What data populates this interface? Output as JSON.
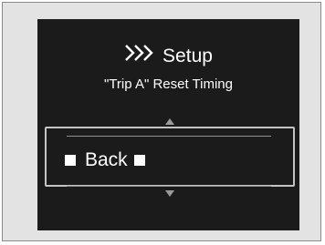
{
  "screen": {
    "title": "Setup",
    "title_icon": "triple-chevron-right-icon",
    "subtitle": "\"Trip A\" Reset Timing"
  },
  "selector": {
    "selected_option": "Back",
    "scroll_up_icon": "triangle-up-icon",
    "scroll_down_icon": "triangle-down-icon"
  },
  "colors": {
    "screen_background": "#1b1b1b",
    "text": "#ffffff",
    "frame_background": "#e3e3e3"
  }
}
